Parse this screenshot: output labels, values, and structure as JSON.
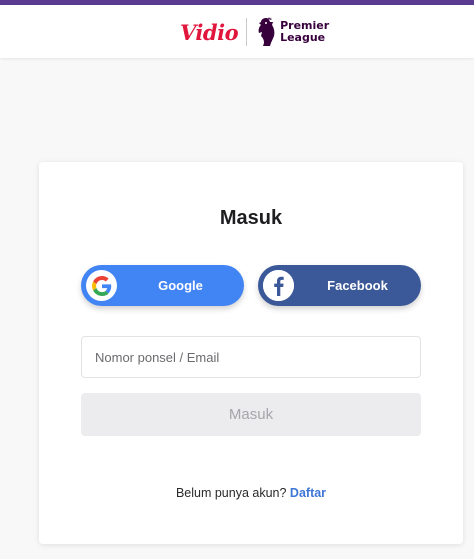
{
  "header": {
    "brand_logo_text": "Vidio",
    "partner_line1": "Premier",
    "partner_line2": "League",
    "accent_color": "#5a3b8f"
  },
  "login": {
    "title": "Masuk",
    "google_label": "Google",
    "facebook_label": "Facebook",
    "input_placeholder": "Nomor ponsel / Email",
    "input_value": "",
    "submit_label": "Masuk",
    "signup_prompt": "Belum punya akun?",
    "signup_link": "Daftar"
  },
  "colors": {
    "google_button": "#4184f3",
    "facebook_button": "#3b5998",
    "vidio_brand": "#e0163d",
    "premier_league": "#37003c",
    "link": "#3d76d6"
  },
  "icons": {
    "google": "google-icon",
    "facebook": "facebook-icon",
    "premier_league": "premier-league-lion-icon"
  }
}
